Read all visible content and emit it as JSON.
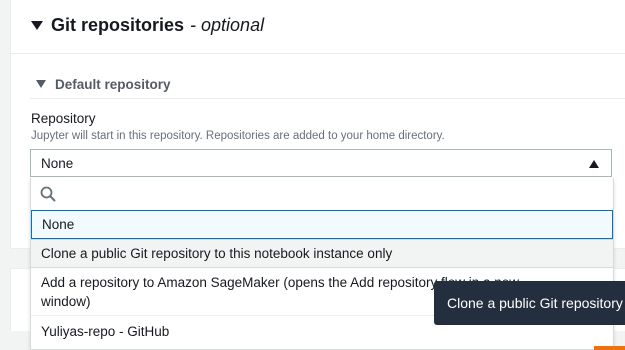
{
  "section": {
    "title": "Git repositories",
    "optional": "- optional"
  },
  "subsection": {
    "title": "Default repository"
  },
  "repository_field": {
    "label": "Repository",
    "description": "Jupyter will start in this repository. Repositories are added to your home directory.",
    "selected_value": "None",
    "search_placeholder": ""
  },
  "dropdown": {
    "options": [
      {
        "label": "None",
        "state": "selected"
      },
      {
        "label": "Clone a public Git repository to this notebook instance only",
        "state": "hovered"
      },
      {
        "label": "Add a repository to Amazon SageMaker (opens the Add repository flow in a new window)",
        "state": "normal"
      },
      {
        "label": "Yuliyas-repo - GitHub",
        "state": "normal"
      }
    ]
  },
  "tooltip": {
    "text": "Clone a public Git repository"
  },
  "colors": {
    "selected_border": "#0073bb",
    "selected_bg": "#f1faff",
    "hover_bg": "#f2f3f3",
    "tooltip_bg": "#232f3e",
    "accent_orange": "#ec7211"
  },
  "icons": {
    "search": "search-icon",
    "expand": "caret-down-icon",
    "select": "caret-up-icon"
  }
}
